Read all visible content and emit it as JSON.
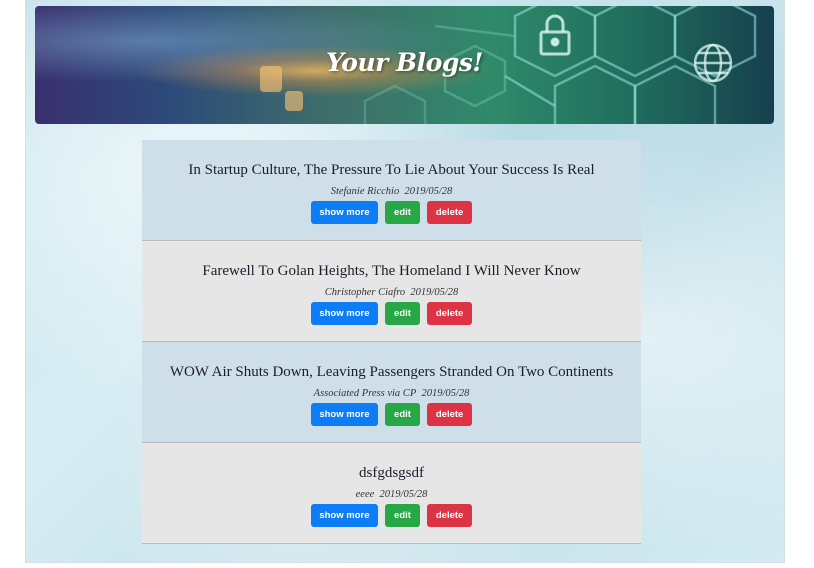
{
  "header": {
    "title": "Your Blogs!"
  },
  "blogs": [
    {
      "title": "In Startup Culture, The Pressure To Lie About Your Success Is Real",
      "author": "Stefanie Ricchio",
      "date": "2019/05/28"
    },
    {
      "title": "Farewell To Golan Heights, The Homeland I Will Never Know",
      "author": "Christopher Ciafro",
      "date": "2019/05/28"
    },
    {
      "title": "WOW Air Shuts Down, Leaving Passengers Stranded On Two Continents",
      "author": "Associated Press via CP",
      "date": "2019/05/28"
    },
    {
      "title": "dsfgdsgsdf",
      "author": "eeee",
      "date": "2019/05/28"
    }
  ],
  "actions": {
    "show_more": "show more",
    "edit": "edit",
    "delete": "delete"
  },
  "colors": {
    "show_more": "#0d7df5",
    "edit": "#27a745",
    "delete": "#dc3444",
    "card_blue": "#cfdfea",
    "card_grey": "#e6e6e6"
  },
  "icons": {
    "banner": [
      "lock-icon",
      "globe-icon",
      "hexagon-network-icon"
    ]
  }
}
